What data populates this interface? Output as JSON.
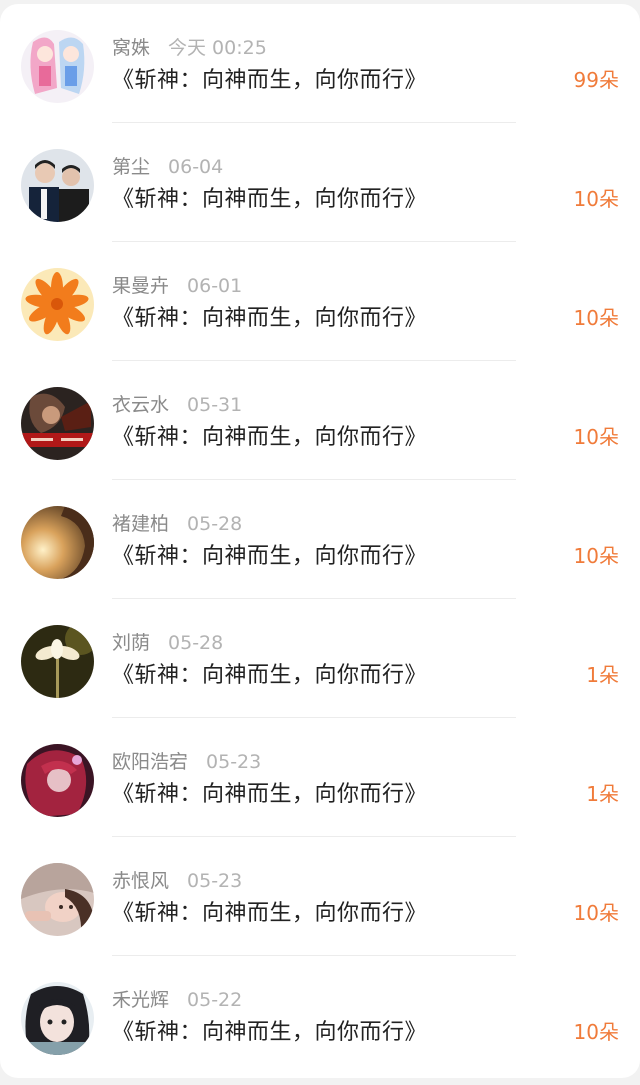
{
  "accent_color": "#f07b3a",
  "records": [
    {
      "name": "窝姝",
      "time": "今天 00:25",
      "title": "《斩神：向神而生，向你而行》",
      "count": "99朵",
      "avatar_icon": "anime-girls-avatar"
    },
    {
      "name": "第尘",
      "time": "06-04",
      "title": "《斩神：向神而生，向你而行》",
      "count": "10朵",
      "avatar_icon": "two-boys-avatar"
    },
    {
      "name": "果曼卉",
      "time": "06-01",
      "title": "《斩神：向神而生，向你而行》",
      "count": "10朵",
      "avatar_icon": "orange-flower-avatar"
    },
    {
      "name": "衣云水",
      "time": "05-31",
      "title": "《斩神：向神而生，向你而行》",
      "count": "10朵",
      "avatar_icon": "dark-portrait-avatar"
    },
    {
      "name": "褚建柏",
      "time": "05-28",
      "title": "《斩神：向神而生，向你而行》",
      "count": "10朵",
      "avatar_icon": "sunset-silhouette-avatar"
    },
    {
      "name": "刘荫",
      "time": "05-28",
      "title": "《斩神：向神而生，向你而行》",
      "count": "1朵",
      "avatar_icon": "white-flower-avatar"
    },
    {
      "name": "欧阳浩宕",
      "time": "05-23",
      "title": "《斩神：向神而生，向你而行》",
      "count": "1朵",
      "avatar_icon": "red-hair-avatar"
    },
    {
      "name": "赤恨风",
      "time": "05-23",
      "title": "《斩神：向神而生，向你而行》",
      "count": "10朵",
      "avatar_icon": "girl-portrait-avatar"
    },
    {
      "name": "禾光辉",
      "time": "05-22",
      "title": "《斩神：向神而生，向你而行》",
      "count": "10朵",
      "avatar_icon": "bangs-girl-avatar"
    }
  ]
}
